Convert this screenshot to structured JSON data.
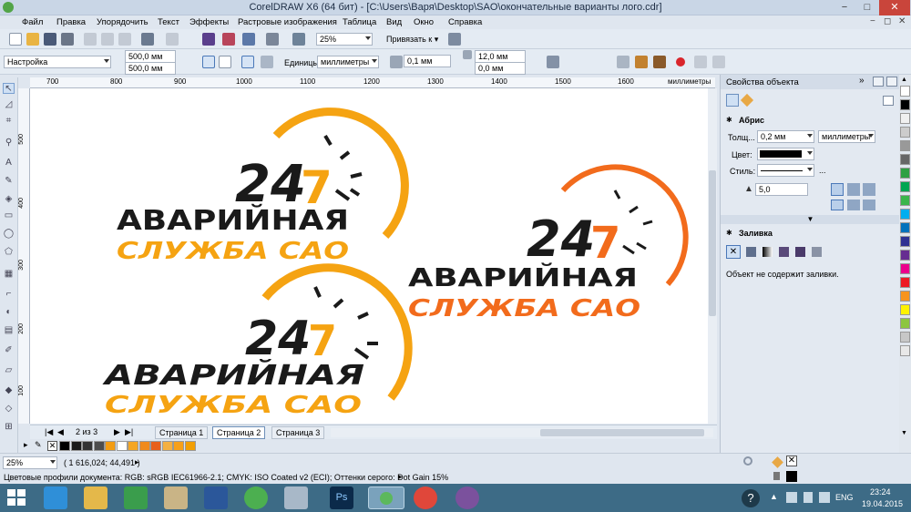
{
  "window": {
    "title": "CorelDRAW X6 (64 бит) - [C:\\Users\\Варя\\Desktop\\SAO\\окончательные варианты лого.cdr]",
    "min": "−",
    "max": "□",
    "close": "✕"
  },
  "menu": [
    "Файл",
    "Правка",
    "Упорядочить",
    "Текст",
    "Эффекты",
    "Растровые изображения",
    "Таблица",
    "Вид",
    "Окно",
    "Справка"
  ],
  "mdi": {
    "min": "−",
    "restore": "◻",
    "close": "✕"
  },
  "toolbar1": {
    "zoom": "25%",
    "snap": "Привязать к"
  },
  "toolbar2": {
    "preset": "Настройка",
    "width": "500,0 мм",
    "height": "500,0 мм",
    "units_label": "Единицы:",
    "units": "миллиметры",
    "nudge": "0,1 мм",
    "dup_x": "12,0 мм",
    "dup_y": "0,0 мм"
  },
  "ruler": {
    "h_labels": [
      "700",
      "800",
      "900",
      "1000",
      "1100",
      "1200",
      "1300",
      "1400",
      "1500",
      "1600"
    ],
    "h_unit": "миллиметры",
    "v_labels": [
      "500",
      "400",
      "300",
      "200",
      "100"
    ]
  },
  "logo": {
    "digits_a": "24",
    "digits_b": "7",
    "line1": "АВАРИЙНАЯ",
    "line2": "СЛУЖБА САО"
  },
  "pages": {
    "counter": "2 из 3",
    "tabs": [
      "Страница 1",
      "Страница 2",
      "Страница 3"
    ],
    "first": "|◀",
    "prev": "◀",
    "next": "▶",
    "last": "▶|"
  },
  "docker": {
    "title": "Свойства объекта",
    "outline_header": "Абрис",
    "thickness_label": "Толщ...",
    "thickness": "0,2 мм",
    "thickness_units": "миллиметры",
    "color_label": "Цвет:",
    "style_label": "Стиль:",
    "style_more": "...",
    "miter": "5,0",
    "fill_header": "Заливка",
    "fill_note": "Объект не содержит заливки."
  },
  "status": {
    "zoom": "25%",
    "coords": "( 1 616,024; 44,491 )",
    "profiles": "Цветовые профили документа: RGB: sRGB IEC61966-2.1; CMYK: ISO Coated v2 (ECI); Оттенки серого: Dot Gain 15%"
  },
  "taskbar": {
    "lang": "ENG",
    "time": "23:24",
    "date": "19.04.2015"
  },
  "colors": {
    "orange": "#f5a312",
    "deep_orange": "#f26b1c",
    "black": "#1a1a1a",
    "taskbar": "#3d6b86",
    "selected_app": "#7aa2bc"
  },
  "palette_h": [
    "#000000",
    "#1a1a1a",
    "#333333",
    "#4d4d4d",
    "#f39c12",
    "#ffffff",
    "#f5a623",
    "#f08a1c",
    "#e8601c",
    "#f5b041",
    "#f7a01a",
    "#f29f05"
  ],
  "palette_v": [
    "#ffffff",
    "#000000",
    "#f0f0f0",
    "#cccccc",
    "#999999",
    "#666666",
    "#2ea043",
    "#00a651",
    "#39b54a",
    "#00aeef",
    "#0072bc",
    "#2e3192",
    "#662d91",
    "#ec008c",
    "#ed1c24",
    "#f7941d",
    "#fff200",
    "#8dc63f",
    "#c7c7c7",
    "#e8e8e8"
  ]
}
